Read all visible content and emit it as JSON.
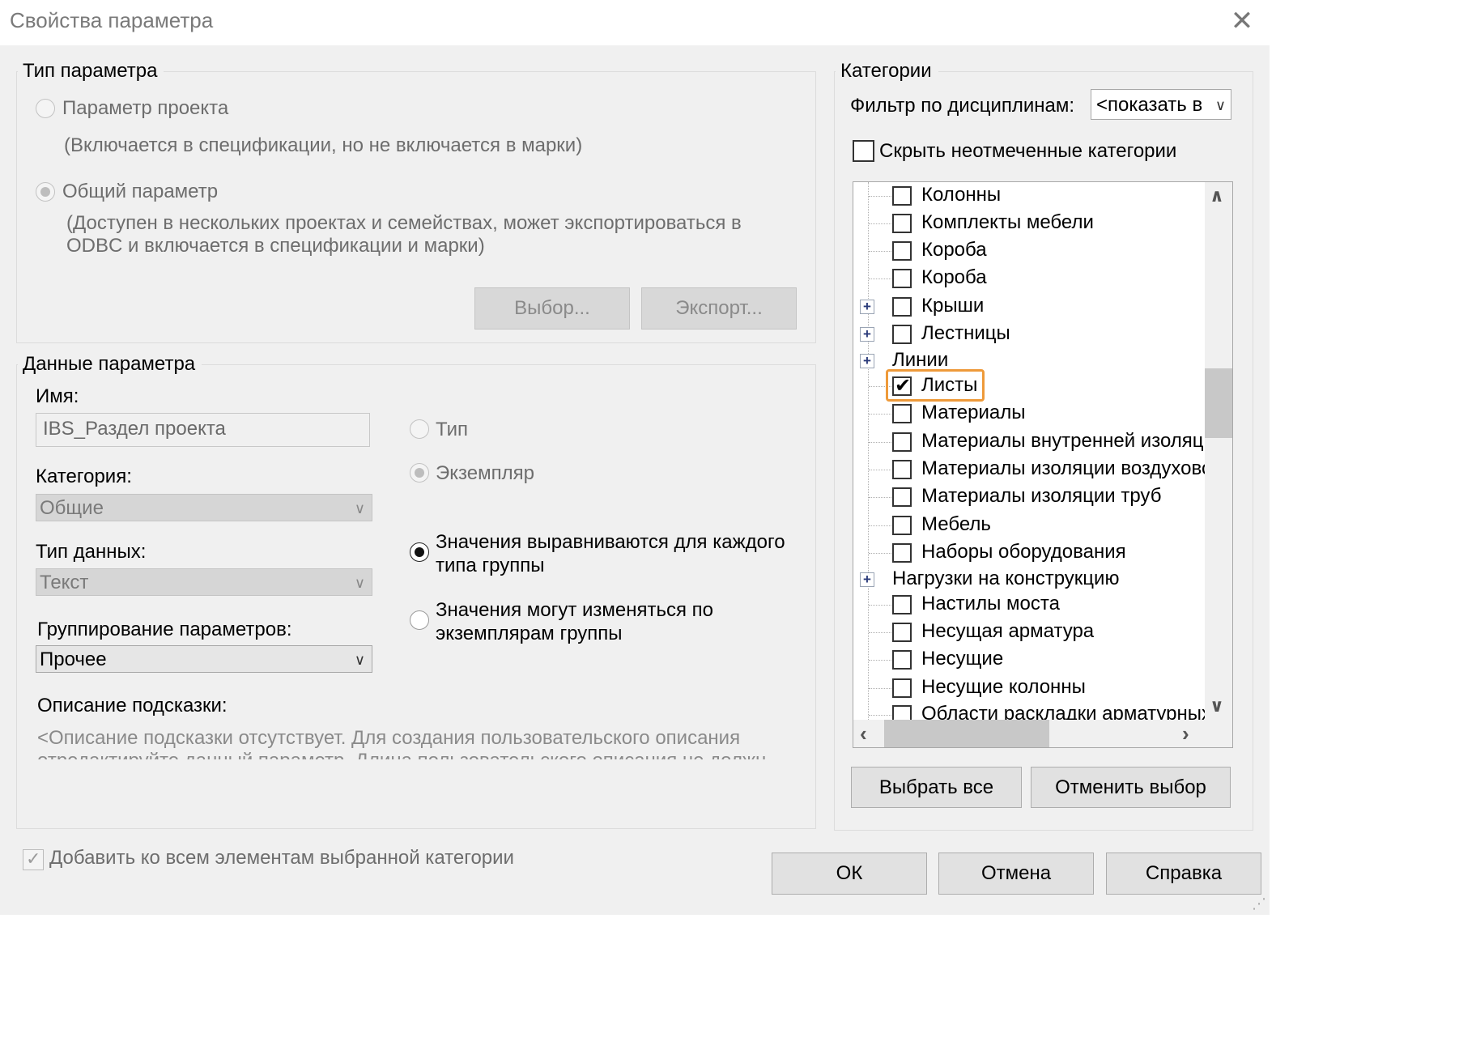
{
  "window": {
    "title": "Свойства параметра",
    "close_icon": "close-icon"
  },
  "param_type": {
    "legend": "Тип параметра",
    "project_label": "Параметр проекта",
    "project_desc": "(Включается в спецификации, но не включается в марки)",
    "shared_label": "Общий параметр",
    "shared_desc_1": "(Доступен в нескольких проектах и семействах, может экспортироваться в",
    "shared_desc_2": "ODBC и включается в спецификации и марки)",
    "select_btn": "Выбор...",
    "export_btn": "Экспорт...",
    "selected": "shared"
  },
  "param_data": {
    "legend": "Данные параметра",
    "name_label": "Имя:",
    "name_value": "IBS_Раздел проекта",
    "category_label": "Категория:",
    "category_value": "Общие",
    "datatype_label": "Тип данных:",
    "datatype_value": "Текст",
    "grouping_label": "Группирование параметров:",
    "grouping_value": "Прочее",
    "type_label": "Тип",
    "instance_label": "Экземпляр",
    "align_label_1": "Значения выравниваются для каждого",
    "align_label_2": "типа группы",
    "vary_label_1": "Значения могут изменяться по",
    "vary_label_2": "экземплярам группы",
    "tooltip_label": "Описание подсказки:",
    "tooltip_text_1": "<Описание подсказки отсутствует. Для создания пользовательского описания",
    "tooltip_text_2": "отредактируйте данный параметр. Длина пользовательского описания не должна"
  },
  "categories": {
    "legend": "Категории",
    "filter_label": "Фильтр по дисциплинам:",
    "filter_value": "<показать в",
    "hide_unchecked_label": "Скрыть неотмеченные категории",
    "items": [
      {
        "label": "Колонны",
        "checked": false,
        "expander": false,
        "checkbox": true
      },
      {
        "label": "Комплекты мебели",
        "checked": false,
        "expander": false,
        "checkbox": true
      },
      {
        "label": "Короба",
        "checked": false,
        "expander": false,
        "checkbox": true
      },
      {
        "label": "Короба",
        "checked": false,
        "expander": false,
        "checkbox": true
      },
      {
        "label": "Крыши",
        "checked": false,
        "expander": true,
        "checkbox": true
      },
      {
        "label": "Лестницы",
        "checked": false,
        "expander": true,
        "checkbox": true
      },
      {
        "label": "Линии",
        "checked": false,
        "expander": true,
        "checkbox": false
      },
      {
        "label": "Листы",
        "checked": true,
        "expander": false,
        "checkbox": true,
        "highlighted": true
      },
      {
        "label": "Материалы",
        "checked": false,
        "expander": false,
        "checkbox": true
      },
      {
        "label": "Материалы внутренней изоляци",
        "checked": false,
        "expander": false,
        "checkbox": true
      },
      {
        "label": "Материалы изоляции воздухово",
        "checked": false,
        "expander": false,
        "checkbox": true
      },
      {
        "label": "Материалы изоляции труб",
        "checked": false,
        "expander": false,
        "checkbox": true
      },
      {
        "label": "Мебель",
        "checked": false,
        "expander": false,
        "checkbox": true
      },
      {
        "label": "Наборы оборудования",
        "checked": false,
        "expander": false,
        "checkbox": true
      },
      {
        "label": "Нагрузки на конструкцию",
        "checked": false,
        "expander": true,
        "checkbox": false
      },
      {
        "label": "Настилы моста",
        "checked": false,
        "expander": false,
        "checkbox": true
      },
      {
        "label": "Несущая арматура",
        "checked": false,
        "expander": false,
        "checkbox": true
      },
      {
        "label": "Несущие",
        "checked": false,
        "expander": false,
        "checkbox": true
      },
      {
        "label": "Несущие колонны",
        "checked": false,
        "expander": false,
        "checkbox": true
      },
      {
        "label": "Области раскладки арматурных",
        "checked": false,
        "expander": false,
        "checkbox": true
      }
    ],
    "select_all_btn": "Выбрать все",
    "deselect_btn": "Отменить выбор"
  },
  "footer": {
    "add_all_label": "Добавить ко всем элементам выбранной категории",
    "ok_btn": "ОК",
    "cancel_btn": "Отмена",
    "help_btn": "Справка"
  },
  "colors": {
    "highlight": "#ee9a3a",
    "dialog_bg": "#f0f0f0"
  }
}
